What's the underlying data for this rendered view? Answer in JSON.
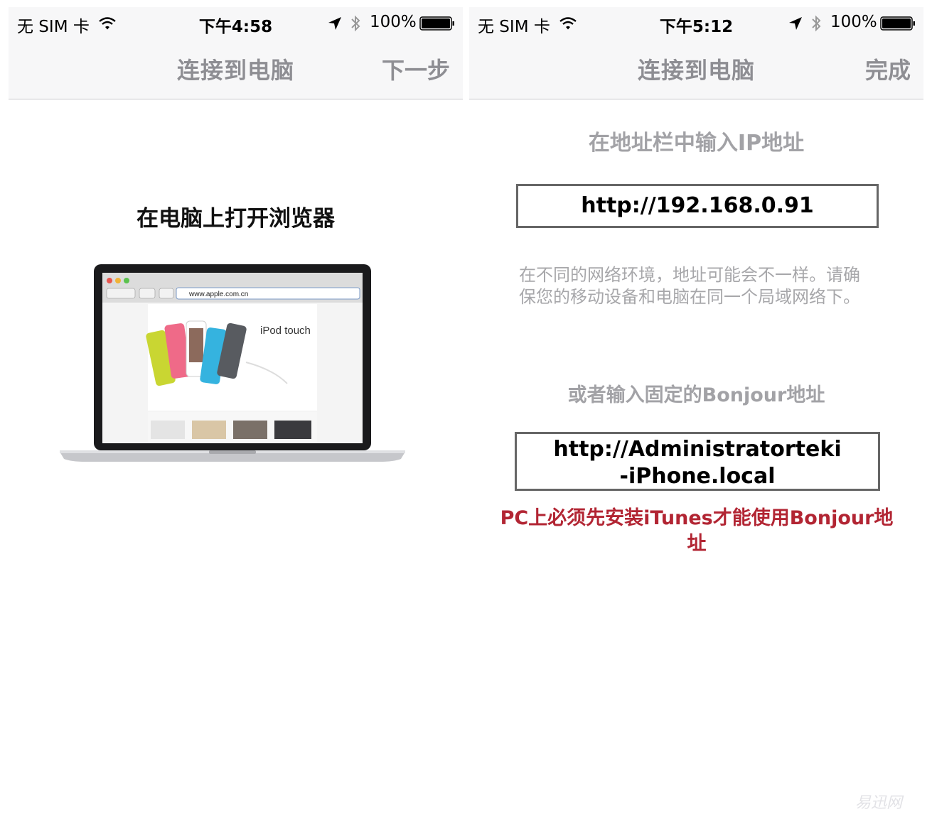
{
  "left": {
    "status": {
      "carrier": "无 SIM 卡",
      "time": "下午4:58",
      "battery": "100%"
    },
    "nav": {
      "title": "连接到电脑",
      "action": "下一步"
    },
    "heading": "在电脑上打开浏览器",
    "laptop": {
      "url": "www.apple.com.cn",
      "product": "iPod touch"
    }
  },
  "right": {
    "status": {
      "carrier": "无 SIM 卡",
      "time": "下午5:12",
      "battery": "100%"
    },
    "nav": {
      "title": "连接到电脑",
      "action": "完成"
    },
    "ip_label": "在地址栏中输入IP地址",
    "ip_address": "http://192.168.0.91",
    "network_hint": "在不同的网络环境，地址可能会不一样。请确保您的移动设备和电脑在同一个局域网络下。",
    "bonjour_label": "或者输入固定的Bonjour地址",
    "bonjour_address": "http://Administratorteki-iPhone.local",
    "itunes_warning": "PC上必须先安装iTunes才能使用Bonjour地址"
  },
  "watermark": "易迅网",
  "colors": {
    "warning": "#b22533",
    "nav_text": "#8e8e93",
    "bar_bg": "#f7f7f8"
  }
}
